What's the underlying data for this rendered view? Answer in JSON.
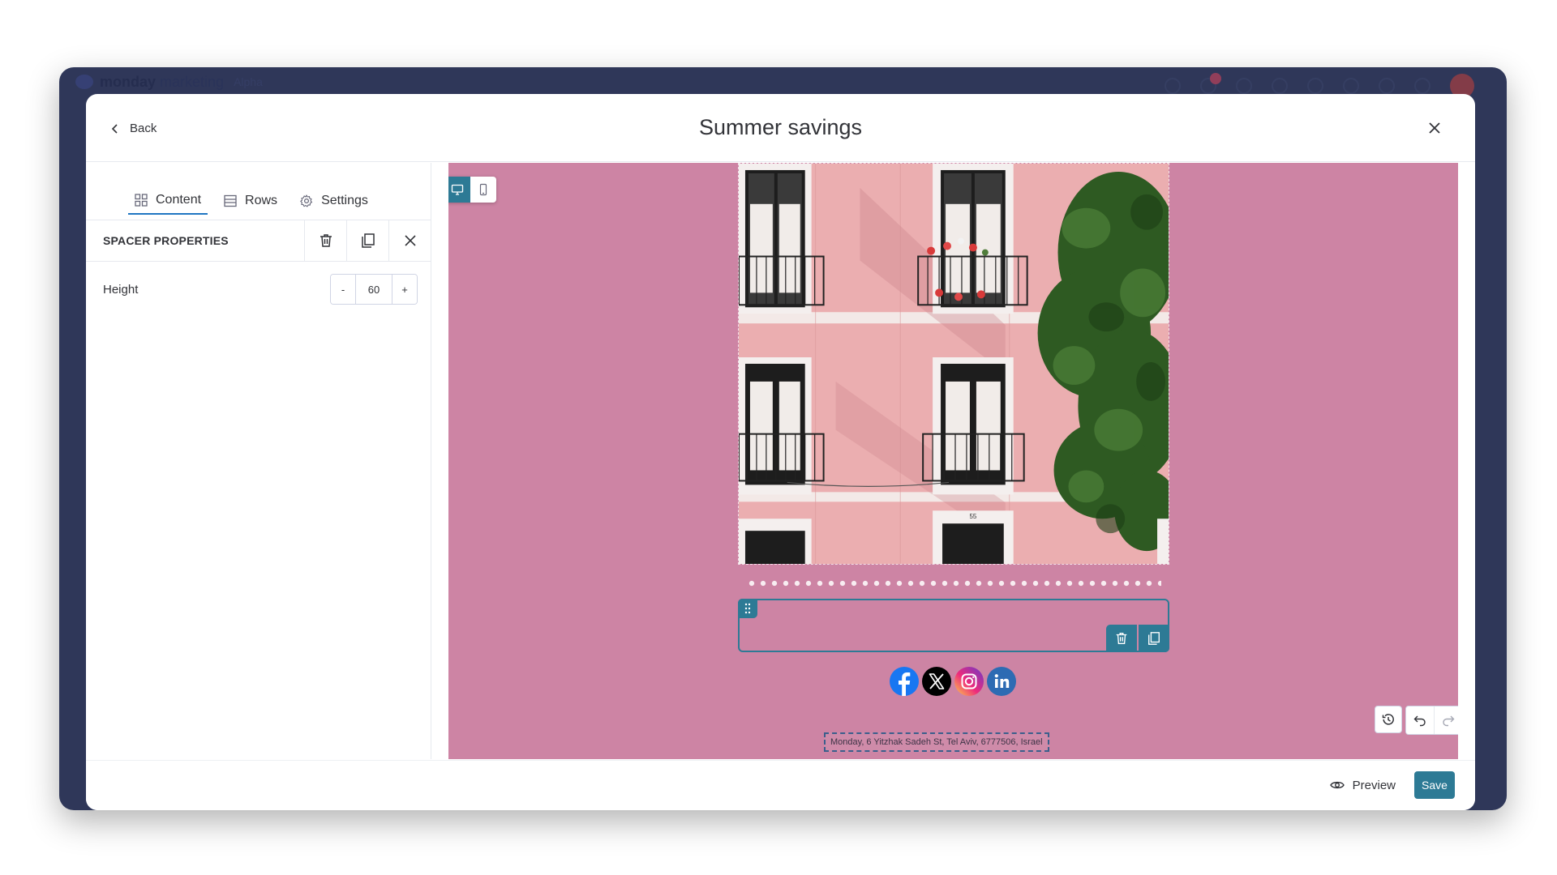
{
  "app": {
    "name_bold": "monday",
    "name_light": "marketing",
    "badge": "Alpha"
  },
  "modal": {
    "back_label": "Back",
    "title": "Summer savings"
  },
  "tabs": [
    {
      "label": "Content",
      "icon": "grid-icon",
      "active": true
    },
    {
      "label": "Rows",
      "icon": "rows-icon",
      "active": false
    },
    {
      "label": "Settings",
      "icon": "gear-icon",
      "active": false
    }
  ],
  "properties": {
    "title": "SPACER PROPERTIES",
    "height_label": "Height",
    "height_value": "60",
    "decrement": "-",
    "increment": "+"
  },
  "canvas": {
    "background_color": "#cd84a4",
    "address": "Monday, 6 Yitzhak Sadeh St, Tel Aviv, 6777506, Israel",
    "socials": [
      "facebook-icon",
      "x-icon",
      "instagram-icon",
      "linkedin-icon"
    ]
  },
  "footer": {
    "preview_label": "Preview",
    "save_label": "Save"
  },
  "colors": {
    "accent": "#2d7a95",
    "backdrop": "#2f3759"
  }
}
